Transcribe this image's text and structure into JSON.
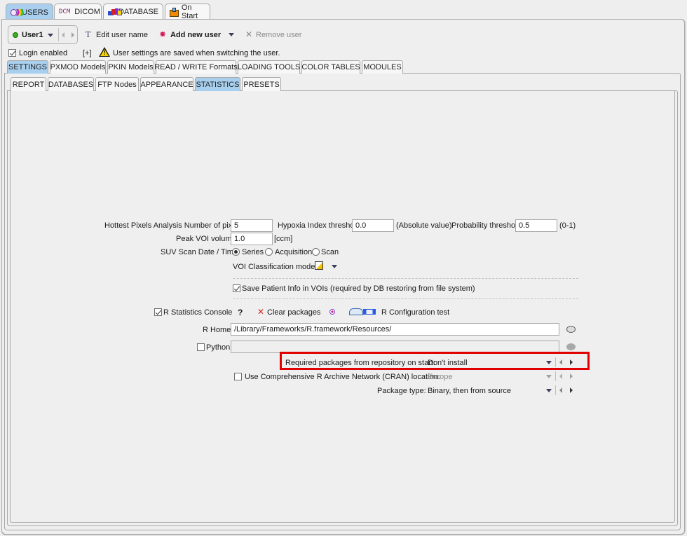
{
  "top_tabs": [
    {
      "label": "USERS",
      "icon": "users-icon",
      "active": true
    },
    {
      "label": "DICOM",
      "icon_text": "DCM",
      "active": false
    },
    {
      "label": "DATABASE",
      "icon": "database-icon",
      "active": false
    },
    {
      "label": "On Start",
      "icon": "on-start-icon",
      "active": false
    }
  ],
  "user_bar": {
    "current_user": "User1",
    "status_color": "#3cb021",
    "edit_user_name": "Edit user name",
    "add_new_user": "Add new user",
    "remove_user": "Remove user"
  },
  "login": {
    "login_enabled_label": "Login enabled",
    "login_enabled": true,
    "expand": "[+]",
    "warning": "User settings are saved when switching the user."
  },
  "section_tabs": [
    {
      "label": "SETTINGS",
      "active": true
    },
    {
      "label": "PXMOD Models",
      "active": false
    },
    {
      "label": "PKIN Models",
      "active": false
    },
    {
      "label": "READ / WRITE Formats",
      "active": false
    },
    {
      "label": "LOADING TOOLS",
      "active": false
    },
    {
      "label": "COLOR TABLES",
      "active": false
    },
    {
      "label": "MODULES",
      "active": false
    }
  ],
  "settings_tabs": [
    {
      "label": "REPORT",
      "active": false
    },
    {
      "label": "DATABASES",
      "active": false
    },
    {
      "label": "FTP Nodes",
      "active": false
    },
    {
      "label": "APPEARANCE",
      "active": false
    },
    {
      "label": "STATISTICS",
      "active": true
    },
    {
      "label": "PRESETS",
      "active": false
    }
  ],
  "statistics": {
    "hottest_pixels_label": "Hottest Pixels Analysis Number of pixels",
    "hottest_pixels_value": "5",
    "hypoxia_label": "Hypoxia Index threshold",
    "hypoxia_value": "0.0",
    "hypoxia_unit": "(Absolute value)",
    "probability_label": "Probability threshold",
    "probability_value": "0.5",
    "probability_unit": "(0-1)",
    "peak_voi_label": "Peak VOI volume",
    "peak_voi_value": "1.0",
    "peak_voi_unit": "[ccm]",
    "suv_label": "SUV Scan Date / Time",
    "suv_options": [
      "Series",
      "Acquisition",
      "Scan"
    ],
    "suv_selected": "Series",
    "voi_class_label": "VOI Classification mode:",
    "save_patient_info_label": "Save Patient Info in VOIs (required by DB restoring from file system)",
    "save_patient_info": true
  },
  "r_section": {
    "console_label": "R Statistics Console",
    "console_enabled": true,
    "help": "?",
    "clear_packages": "Clear packages",
    "config_test": "R Configuration test",
    "r_home_label": "R Home",
    "r_home_value": "/Library/Frameworks/R.framework/Resources/",
    "python_label": "Python",
    "python_enabled": false,
    "python_value": "",
    "required_packages_label": "Required packages from repository on start:",
    "required_packages_value": "Don't install",
    "cran_label": "Use Comprehensive R Archive Network (CRAN) location:",
    "cran_enabled": false,
    "cran_value": "Europe",
    "package_type_label": "Package type:",
    "package_type_value": "Binary, then from source"
  },
  "highlight_color": "#e00000"
}
